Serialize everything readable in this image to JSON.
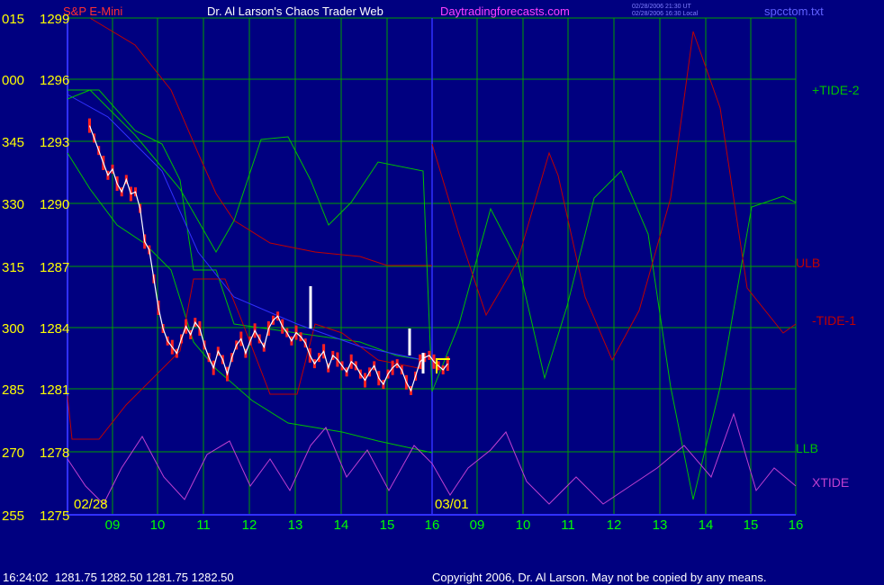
{
  "header": {
    "symbol": "S&P E-Mini",
    "title": "Dr. Al Larson's Chaos Trader Web",
    "site": "Daytradingforecasts.com",
    "timestamp_ut": "02/28/2006 21:30 UT",
    "timestamp_local": "02/28/2006 16:30 Local",
    "filename": "spcctom.txt"
  },
  "footer": {
    "quote": "16:24:02  1281.75 1282.50 1281.75 1282.50",
    "copyright": "Copyright 2006, Dr. Al Larson. May not be copied by any means."
  },
  "colors": {
    "background": "#000080",
    "grid": "#00A000",
    "price": "#FF2020",
    "envelope": "#00C000",
    "ulb": "#C00000",
    "xtide": "#C040D0",
    "tide": "#00C000",
    "time_axis": "#00FF00",
    "price_labels": "#FFFF00",
    "date_labels": "#FFFF00"
  },
  "chart_data": {
    "type": "line",
    "title": "S&P E-Mini",
    "y_axis": {
      "angle_labels": [
        "015",
        "000",
        "345",
        "330",
        "315",
        "300",
        "285",
        "270",
        "255"
      ],
      "price_labels": [
        "1299",
        "1296",
        "1293",
        "1290",
        "1287",
        "1284",
        "1281",
        "1278",
        "1275"
      ],
      "price_range": [
        1275,
        1299
      ]
    },
    "x_axis": {
      "hour_labels": [
        "09",
        "10",
        "11",
        "12",
        "13",
        "14",
        "15",
        "16",
        "09",
        "10",
        "11",
        "12",
        "13",
        "14",
        "15",
        "16"
      ],
      "date_labels": [
        "02/28",
        "03/01"
      ]
    },
    "right_labels": [
      "+TIDE-2",
      "ULB",
      "-TIDE-1",
      "LLB",
      "XTIDE"
    ],
    "series": [
      {
        "name": "S&P E-Mini",
        "x": [
          0,
          0.1,
          0.2,
          0.3,
          0.4,
          0.5,
          0.6,
          0.7,
          0.8,
          0.9,
          1.0,
          1.1,
          1.2,
          1.3,
          1.4,
          1.5,
          1.6,
          1.7,
          1.8,
          1.9,
          2.0,
          2.1,
          2.2,
          2.3,
          2.4,
          2.5,
          2.6,
          2.7,
          2.8,
          2.9,
          3.0,
          3.1,
          3.2,
          3.3,
          3.4,
          3.5,
          3.6,
          3.7,
          3.8,
          3.9,
          4.0,
          4.1,
          4.2,
          4.3,
          4.4,
          4.5,
          4.6,
          4.7,
          4.8,
          4.9,
          5.0,
          5.1,
          5.2,
          5.3,
          5.4,
          5.5,
          5.6,
          5.7,
          5.8,
          5.9,
          6.0,
          6.1,
          6.2,
          6.3,
          6.4,
          6.5,
          6.6,
          6.7,
          6.8,
          6.9,
          7.0,
          7.1,
          7.2,
          7.3,
          7.4,
          7.5,
          7.6,
          7.7,
          7.8
        ],
        "values": [
          1293.8,
          1293.2,
          1292.6,
          1292.0,
          1291.4,
          1291.7,
          1291.0,
          1290.6,
          1291.2,
          1290.5,
          1290.6,
          1289.8,
          1288.2,
          1287.8,
          1286.4,
          1285.0,
          1284.0,
          1283.4,
          1283.1,
          1282.8,
          1283.5,
          1284.1,
          1283.7,
          1284.3,
          1284.0,
          1283.2,
          1282.6,
          1282.1,
          1282.9,
          1282.5,
          1281.8,
          1282.6,
          1283.2,
          1283.5,
          1282.8,
          1283.4,
          1283.9,
          1283.5,
          1283.1,
          1284.0,
          1284.4,
          1284.6,
          1284.1,
          1283.8,
          1283.4,
          1283.8,
          1283.6,
          1283.3,
          1282.7,
          1282.3,
          1282.6,
          1282.9,
          1282.1,
          1282.7,
          1282.5,
          1282.2,
          1281.9,
          1282.4,
          1282.2,
          1281.8,
          1281.5,
          1281.9,
          1282.2,
          1281.6,
          1281.3,
          1281.8,
          1282.1,
          1282.3,
          1282.0,
          1281.4,
          1281.0,
          1281.7,
          1282.4,
          1282.6,
          1282.7,
          1282.4,
          1282.2,
          1282.0,
          1282.3
        ]
      }
    ]
  }
}
